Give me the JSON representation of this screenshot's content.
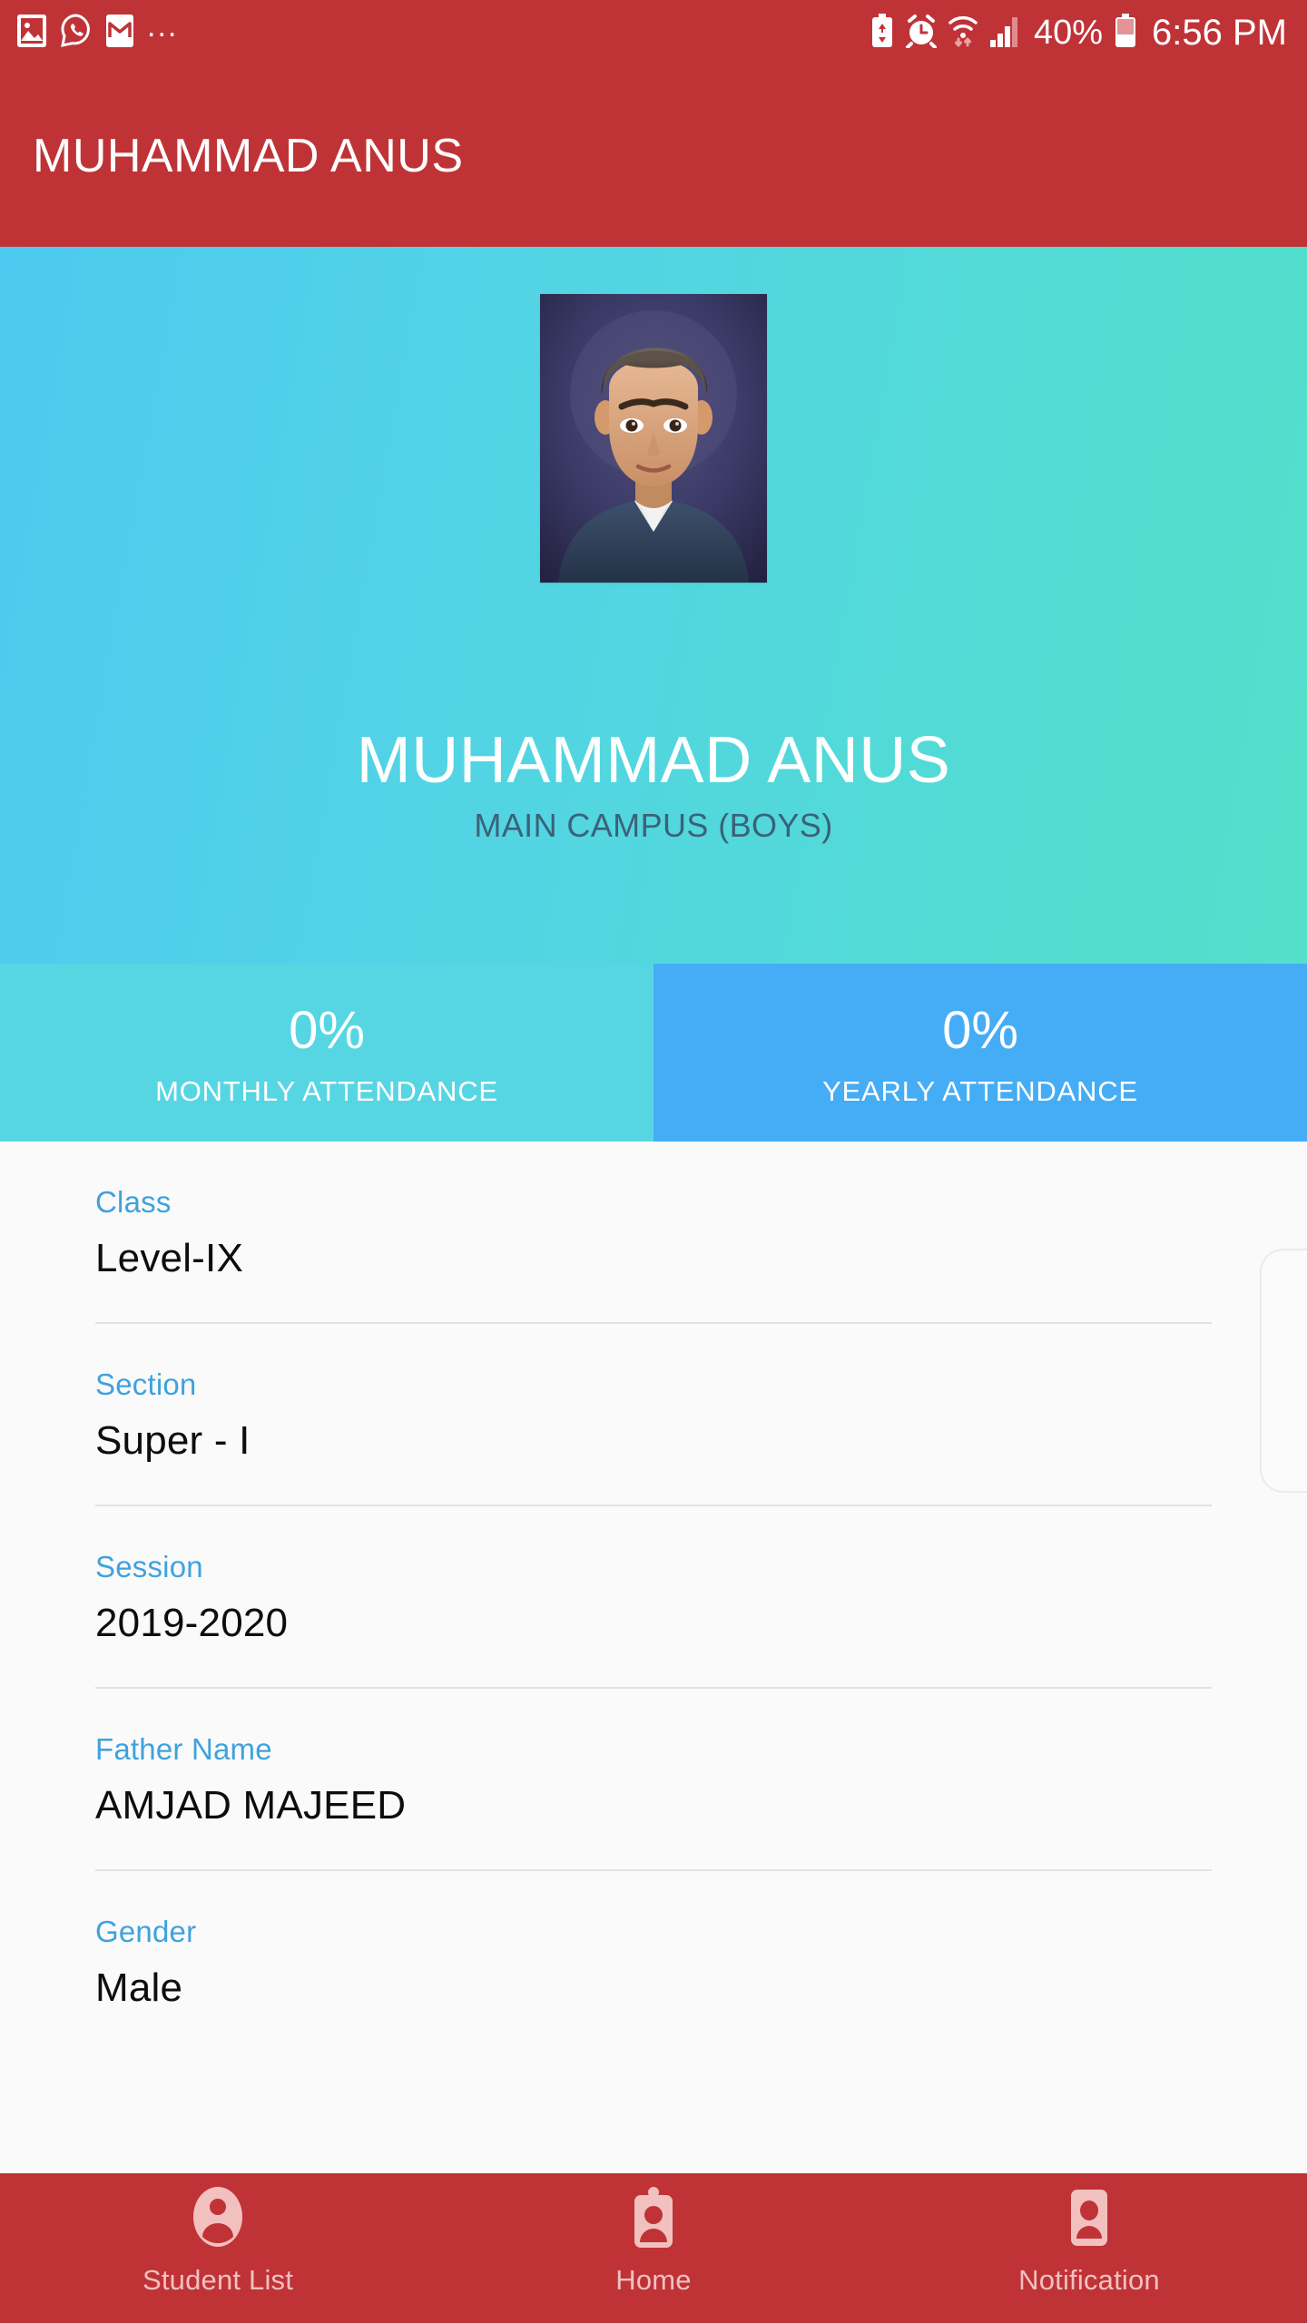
{
  "status_bar": {
    "left_icons": [
      "photos-icon",
      "whatsapp-icon",
      "gmail-icon"
    ],
    "overflow": "...",
    "right_icons": [
      "battery-saver-icon",
      "alarm-icon",
      "wifi-icon",
      "signal-icon",
      "battery-icon"
    ],
    "battery_percent": "40%",
    "time": "6:56 PM"
  },
  "app_bar": {
    "title": "MUHAMMAD ANUS"
  },
  "hero": {
    "avatar_alt": "student-photo",
    "name": "MUHAMMAD ANUS",
    "campus": "MAIN CAMPUS (BOYS)"
  },
  "attendance": [
    {
      "value": "0%",
      "label": "MONTHLY ATTENDANCE",
      "color": "#56d6e3"
    },
    {
      "value": "0%",
      "label": "YEARLY ATTENDANCE",
      "color": "#44adf5"
    }
  ],
  "details": [
    {
      "label": "Class",
      "value": "Level-IX"
    },
    {
      "label": "Section",
      "value": "Super - I"
    },
    {
      "label": "Session",
      "value": "2019-2020"
    },
    {
      "label": "Father Name",
      "value": "AMJAD MAJEED"
    },
    {
      "label": "Gender",
      "value": "Male"
    }
  ],
  "bottom_nav": [
    {
      "label": "Student List",
      "icon": "person-circle-icon"
    },
    {
      "label": "Home",
      "icon": "id-badge-icon"
    },
    {
      "label": "Notification",
      "icon": "contact-card-icon"
    }
  ],
  "colors": {
    "brand_red": "#bf3337",
    "label_blue": "#3fa2dd",
    "hero_gradient_start": "#4ec9ef",
    "hero_gradient_end": "#52e0c9"
  }
}
